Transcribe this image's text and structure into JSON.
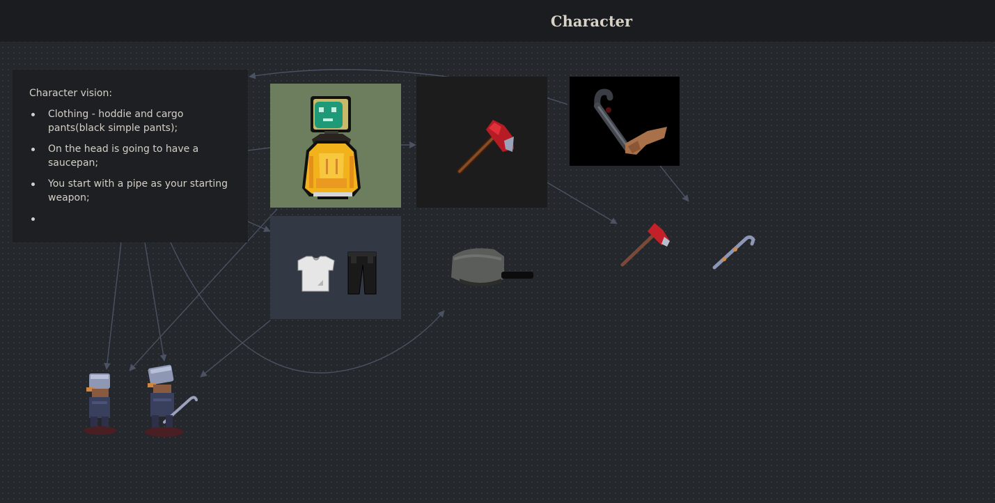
{
  "page": {
    "title": "Character"
  },
  "vision_card": {
    "title": "Character vision:",
    "items": [
      "Clothing - hoddie and cargo pants(black simple pants);",
      "On the head is going to have a saucepan;",
      "You start with a pipe as your starting weapon;",
      ""
    ]
  },
  "theme": {
    "canvas_bg": "#24272b",
    "header_bg": "#1b1c1f",
    "card_bg": "#1e1f22",
    "connector": "#4a5263",
    "text": "#d4d0c8"
  },
  "icons": {
    "hoodie": "hoodie-character-icon",
    "shirt": "white-shirt-icon",
    "pants": "black-pants-icon",
    "axe": "red-axe-icon",
    "pipe": "pipe-weapon-icon",
    "saucepan": "saucepan-icon",
    "sprite": "character-sprite-icon"
  }
}
